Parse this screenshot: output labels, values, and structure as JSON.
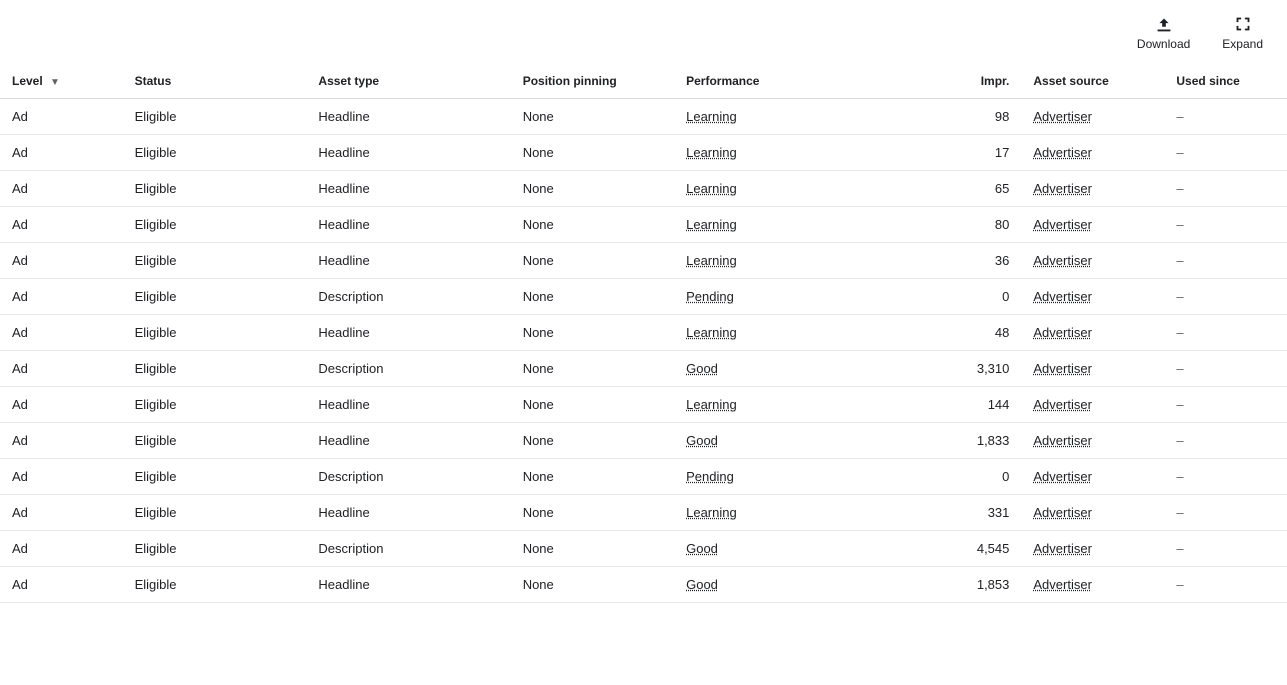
{
  "toolbar": {
    "download_label": "Download",
    "expand_label": "Expand"
  },
  "table": {
    "columns": [
      {
        "key": "level",
        "label": "Level",
        "sortable": true
      },
      {
        "key": "status",
        "label": "Status",
        "sortable": false
      },
      {
        "key": "asset_type",
        "label": "Asset type",
        "sortable": false
      },
      {
        "key": "position_pinning",
        "label": "Position pinning",
        "sortable": false
      },
      {
        "key": "performance",
        "label": "Performance",
        "sortable": false
      },
      {
        "key": "impr",
        "label": "Impr.",
        "sortable": false,
        "align": "right"
      },
      {
        "key": "asset_source",
        "label": "Asset source",
        "sortable": false
      },
      {
        "key": "used_since",
        "label": "Used since",
        "sortable": false
      }
    ],
    "rows": [
      {
        "level": "Ad",
        "status": "Eligible",
        "asset_type": "Headline",
        "position_pinning": "None",
        "performance": "Learning",
        "impr": "98",
        "asset_source": "Advertiser",
        "used_since": "–"
      },
      {
        "level": "Ad",
        "status": "Eligible",
        "asset_type": "Headline",
        "position_pinning": "None",
        "performance": "Learning",
        "impr": "17",
        "asset_source": "Advertiser",
        "used_since": "–"
      },
      {
        "level": "Ad",
        "status": "Eligible",
        "asset_type": "Headline",
        "position_pinning": "None",
        "performance": "Learning",
        "impr": "65",
        "asset_source": "Advertiser",
        "used_since": "–"
      },
      {
        "level": "Ad",
        "status": "Eligible",
        "asset_type": "Headline",
        "position_pinning": "None",
        "performance": "Learning",
        "impr": "80",
        "asset_source": "Advertiser",
        "used_since": "–"
      },
      {
        "level": "Ad",
        "status": "Eligible",
        "asset_type": "Headline",
        "position_pinning": "None",
        "performance": "Learning",
        "impr": "36",
        "asset_source": "Advertiser",
        "used_since": "–"
      },
      {
        "level": "Ad",
        "status": "Eligible",
        "asset_type": "Description",
        "position_pinning": "None",
        "performance": "Pending",
        "impr": "0",
        "asset_source": "Advertiser",
        "used_since": "–"
      },
      {
        "level": "Ad",
        "status": "Eligible",
        "asset_type": "Headline",
        "position_pinning": "None",
        "performance": "Learning",
        "impr": "48",
        "asset_source": "Advertiser",
        "used_since": "–"
      },
      {
        "level": "Ad",
        "status": "Eligible",
        "asset_type": "Description",
        "position_pinning": "None",
        "performance": "Good",
        "impr": "3,310",
        "asset_source": "Advertiser",
        "used_since": "–"
      },
      {
        "level": "Ad",
        "status": "Eligible",
        "asset_type": "Headline",
        "position_pinning": "None",
        "performance": "Learning",
        "impr": "144",
        "asset_source": "Advertiser",
        "used_since": "–"
      },
      {
        "level": "Ad",
        "status": "Eligible",
        "asset_type": "Headline",
        "position_pinning": "None",
        "performance": "Good",
        "impr": "1,833",
        "asset_source": "Advertiser",
        "used_since": "–"
      },
      {
        "level": "Ad",
        "status": "Eligible",
        "asset_type": "Description",
        "position_pinning": "None",
        "performance": "Pending",
        "impr": "0",
        "asset_source": "Advertiser",
        "used_since": "–"
      },
      {
        "level": "Ad",
        "status": "Eligible",
        "asset_type": "Headline",
        "position_pinning": "None",
        "performance": "Learning",
        "impr": "331",
        "asset_source": "Advertiser",
        "used_since": "–"
      },
      {
        "level": "Ad",
        "status": "Eligible",
        "asset_type": "Description",
        "position_pinning": "None",
        "performance": "Good",
        "impr": "4,545",
        "asset_source": "Advertiser",
        "used_since": "–"
      },
      {
        "level": "Ad",
        "status": "Eligible",
        "asset_type": "Headline",
        "position_pinning": "None",
        "performance": "Good",
        "impr": "1,853",
        "asset_source": "Advertiser",
        "used_since": "–"
      }
    ]
  }
}
